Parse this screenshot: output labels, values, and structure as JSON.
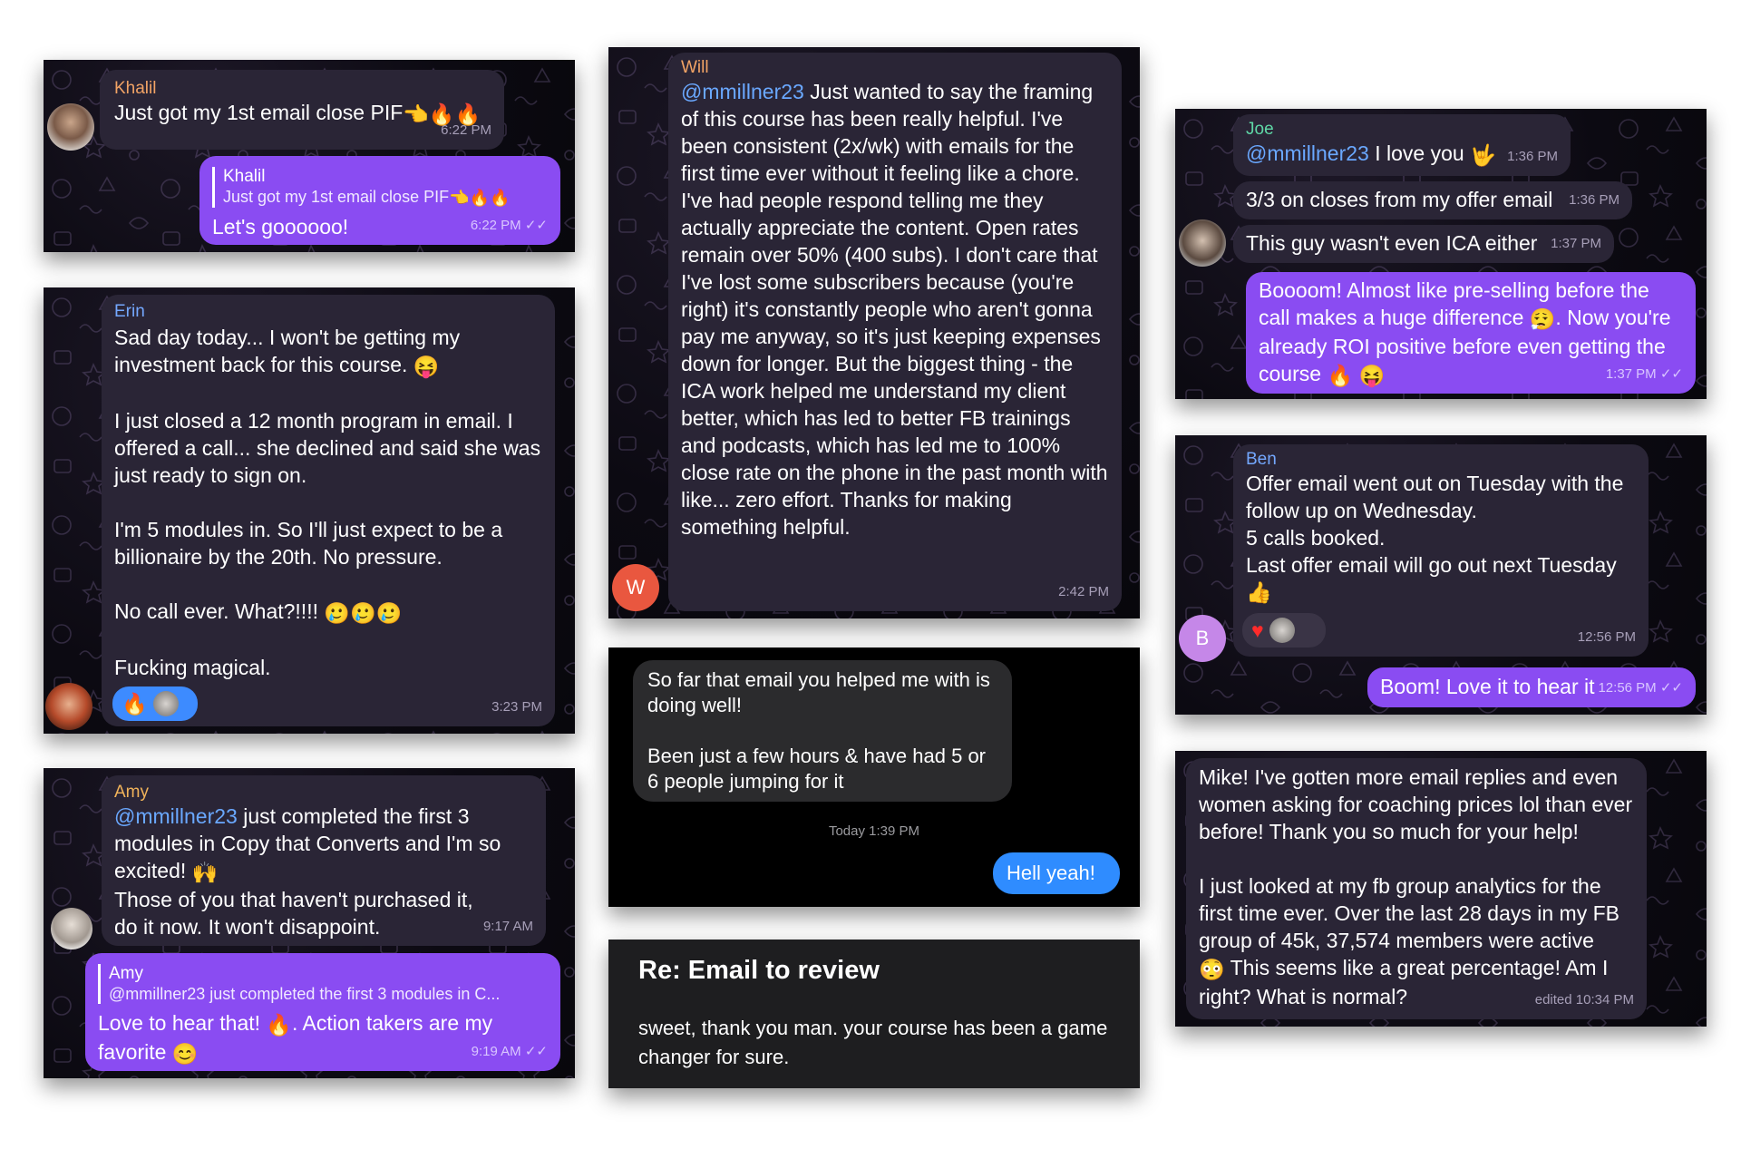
{
  "colors": {
    "incoming": "#2a2536",
    "outgoing": "#8a4cf2",
    "mention": "#6aa8ff",
    "blue": "#2f8cff"
  },
  "khalil": {
    "sender": "Khalil",
    "text": "Just got my 1st email close PIF",
    "time": "6:22 PM",
    "reply_name": "Khalil",
    "reply_text": "Just got my 1st email close PIF",
    "out_text": "Let's goooooo!",
    "out_time": "6:22 PM"
  },
  "erin": {
    "sender": "Erin",
    "p1": "Sad day today... I won't be getting my investment back for this course.",
    "p2": "I just closed a 12 month program in email. I offered a call... she declined and said she was just ready to sign on.",
    "p3": "I'm 5 modules in. So I'll just expect to be a billionaire by the 20th. No pressure.",
    "p4": "No call ever. What?!!!!",
    "p5": "Fucking magical.",
    "time": "3:23 PM"
  },
  "amy": {
    "sender": "Amy",
    "mention": "@mmillner23",
    "text1": " just completed the first 3 modules in Copy that Converts and I'm so excited!",
    "text2": "Those of you that haven't purchased it, do it now. It won't disappoint.",
    "time": "9:17 AM",
    "reply_name": "Amy",
    "reply_text": "@mmillner23 just completed the first 3 modules in C...",
    "out_text1": "Love to hear that!",
    "out_text2": ". Action takers are my favorite",
    "out_time": "9:19 AM"
  },
  "will": {
    "sender": "Will",
    "mention": "@mmillner23",
    "text": " Just wanted to say the framing of this course has been really helpful. I've been consistent (2x/wk) with emails for the first time ever without it feeling like a chore. I've had people respond telling me they actually appreciate the content. Open rates remain over 50% (400 subs). I don't care that I've lost some subscribers because (you're right) it's constantly people who aren't gonna pay me anyway, so it's just keeping expenses down for longer. But the biggest thing - the ICA work helped me understand my client better, which has led to better FB trainings and podcasts, which has led me to 100% close rate on the phone in the past month with like... zero effort. Thanks for making something helpful.",
    "time": "2:42 PM",
    "avatar_letter": "W"
  },
  "imessage": {
    "msg1": "So far that email you helped me with is doing well!",
    "msg2": "Been just a few hours & have had 5 or 6 people jumping for it",
    "timestamp": "Today 1:39 PM",
    "reply": "Hell yeah!"
  },
  "email": {
    "subject": "Re: Email to review",
    "body": "sweet, thank you man. your course has been a game changer for sure."
  },
  "joe": {
    "sender": "Joe",
    "mention": "@mmillner23",
    "m1_text": " I love you",
    "m1_time": "1:36 PM",
    "m2_text": "3/3 on closes from my offer email",
    "m2_time": "1:36 PM",
    "m3_text": "This guy wasn't even ICA either",
    "m3_time": "1:37 PM",
    "out_text1": "Boooom! Almost like pre-selling before the call makes a huge difference",
    "out_text2": ". Now you're already ROI positive before even getting the course",
    "out_time": "1:37 PM"
  },
  "ben": {
    "sender": "Ben",
    "text": "Offer email went out on Tuesday with the follow up on Wednesday.",
    "line2": "5 calls booked.",
    "line3": "Last offer email will go out next Tuesday",
    "time": "12:56 PM",
    "avatar_letter": "B",
    "out_text": "Boom! Love it to hear it",
    "out_time": "12:56 PM"
  },
  "mike": {
    "p1": "Mike! I've gotten more email replies and even women asking for coaching prices lol than ever before! Thank you so much for your help!",
    "p2": "I just looked at my fb group analytics for the first time ever. Over the last 28 days in my FB group of 45k, 37,574 members were active",
    "p3": " This seems like a great percentage! Am I right? What is normal?",
    "time": "edited 10:34 PM"
  }
}
